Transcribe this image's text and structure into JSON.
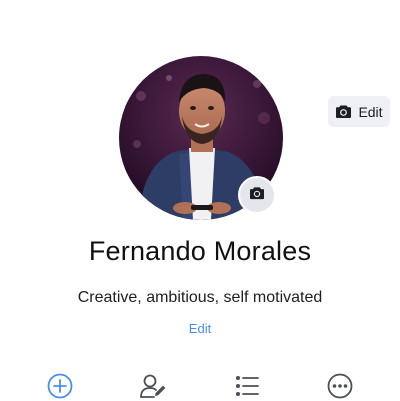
{
  "cover": {
    "edit_label": "Edit",
    "edit_icon": "camera-icon"
  },
  "avatar": {
    "camera_icon": "camera-icon",
    "ring_color": "#ffffff"
  },
  "profile": {
    "name": "Fernando Morales",
    "bio": "Creative, ambitious, self motivated",
    "bio_edit_label": "Edit"
  },
  "actions": [
    {
      "icon": "add-circle-icon",
      "color": "#4a90e2"
    },
    {
      "icon": "edit-person-icon",
      "color": "#4b4f56"
    },
    {
      "icon": "list-icon",
      "color": "#4b4f56"
    },
    {
      "icon": "more-icon",
      "color": "#4b4f56"
    }
  ],
  "colors": {
    "accent": "#4a90e2",
    "text": "#1c1e21"
  }
}
